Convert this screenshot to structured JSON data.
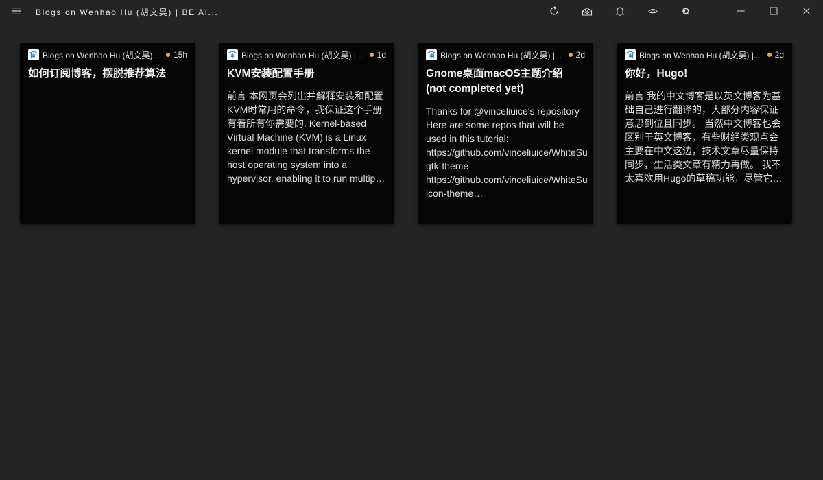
{
  "window": {
    "title": "Blogs on Wenhao Hu (胡文昊) | BE AI...",
    "icons": [
      "menu-icon",
      "refresh-icon",
      "mark-all-read-icon",
      "bell-icon",
      "eye-icon",
      "gear-icon",
      "minimize-icon",
      "maximize-icon",
      "close-icon"
    ]
  },
  "colors": {
    "background": "#242424",
    "card": "#050505",
    "unread_dot": "#f5a34a",
    "text": "#e8e8e8"
  },
  "cards": [
    {
      "source": "Blogs on Wenhao Hu (胡文昊)...",
      "time": "15h",
      "title": "如何订阅博客，摆脱推荐算法",
      "body": []
    },
    {
      "source": "Blogs on Wenhao Hu (胡文昊) |...",
      "time": "1d",
      "title": "KVM安装配置手册",
      "body": [
        "前言 本网页会列出并解释安装和配置",
        "KVM时常用的命令，我保证这个手册",
        "有着所有你需要的. Kernel-based",
        "Virtual Machine (KVM) is a Linux",
        "kernel module that transforms the",
        "host operating system into a",
        "hypervisor, enabling it to run multip…"
      ]
    },
    {
      "source": "Blogs on Wenhao Hu (胡文昊) |...",
      "time": "2d",
      "title": "Gnome桌面macOS主题介绍 (not completed yet)",
      "body": [
        "Thanks for @vinceliuice's repository",
        "Here are some repos that will be",
        "used in this tutorial:",
        "https://github.com/vinceliuice/WhiteSu",
        "gtk-theme",
        "https://github.com/vinceliuice/WhiteSu",
        "icon-theme…"
      ]
    },
    {
      "source": "Blogs on Wenhao Hu (胡文昊) |...",
      "time": "2d",
      "title": "你好，Hugo!",
      "body": [
        "前言 我的中文博客是以英文博客为基",
        "础自己进行翻译的，大部分内容保证",
        "意思到位且同步。 当然中文博客也会",
        "区别于英文博客，有些财经类观点会",
        "主要在中文这边，技术文章尽量保持",
        "同步，生活类文章有精力再做。 我不",
        "太喜欢用Hugo的草稿功能，尽管它…"
      ]
    }
  ]
}
